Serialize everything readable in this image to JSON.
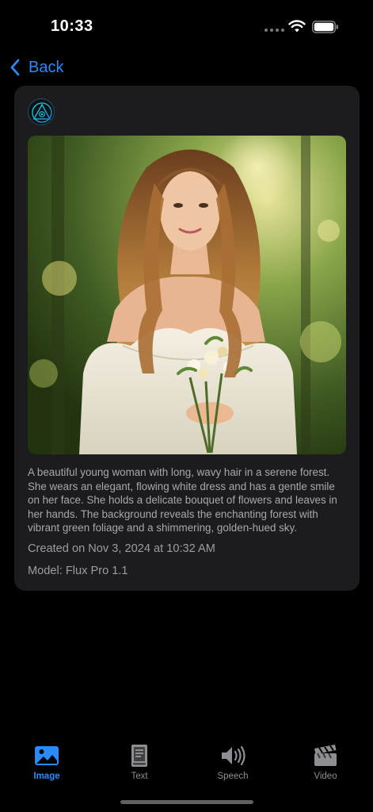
{
  "status_bar": {
    "time": "10:33"
  },
  "nav": {
    "back_label": "Back"
  },
  "post": {
    "description": "A beautiful young woman with long, wavy hair in a serene forest. She wears an elegant, flowing white dress and has a gentle smile on her face. She holds a delicate bouquet of flowers and leaves in her hands. The background reveals the enchanting forest with vibrant green foliage and a shimmering, golden-hued sky.",
    "created": "Created on Nov 3, 2024 at 10:32 AM",
    "model": "Model: Flux Pro 1.1"
  },
  "tabs": [
    {
      "label": "Image",
      "icon": "image-icon",
      "active": true
    },
    {
      "label": "Text",
      "icon": "book-icon",
      "active": false
    },
    {
      "label": "Speech",
      "icon": "speaker-icon",
      "active": false
    },
    {
      "label": "Video",
      "icon": "clapperboard-icon",
      "active": false
    }
  ],
  "colors": {
    "accent": "#2a8bf5",
    "card": "#1c1c1e",
    "background": "#000000"
  }
}
